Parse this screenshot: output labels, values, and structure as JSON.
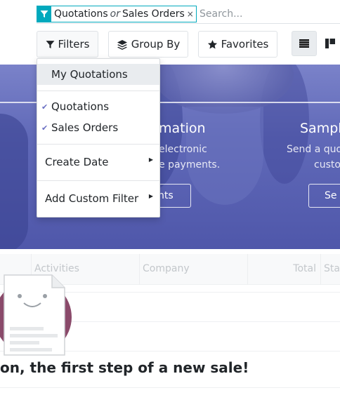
{
  "search": {
    "facet_values": [
      "Quotations",
      "Sales Orders"
    ],
    "facet_separator": "or",
    "facet_remove": "×",
    "placeholder": "Search..."
  },
  "toolbar": {
    "filters_label": "Filters",
    "group_by_label": "Group By",
    "favorites_label": "Favorites"
  },
  "filters_menu": {
    "items": [
      {
        "label": "My Quotations",
        "checked": false,
        "highlighted": true
      },
      {
        "label": "Quotations",
        "checked": true,
        "highlighted": false
      },
      {
        "label": "Sales Orders",
        "checked": true,
        "highlighted": false
      },
      {
        "label": "Create Date",
        "submenu": true
      },
      {
        "label": "Add Custom Filter",
        "submenu": true
      }
    ],
    "check_glyph": "✔",
    "caret_glyph": "▶"
  },
  "hero": {
    "panel1_title": "mation",
    "panel1_line1": "electronic",
    "panel1_line2": "e payments.",
    "panel1_button": "nts",
    "panel2_title": "Sampl",
    "panel2_line1": "Send a quo",
    "panel2_line2": "custo",
    "panel2_button": "Se"
  },
  "table": {
    "columns": [
      "Activities",
      "Company",
      "Total",
      "Sta"
    ]
  },
  "helper": {
    "text": "on, the first step of a new sale!"
  },
  "colors": {
    "accent": "#01a9bd",
    "check": "#6a6fc3",
    "banner": "#5c63b3"
  },
  "icons": {
    "facet": "filter-icon",
    "filters": "filter-icon",
    "group_by": "layers-icon",
    "favorites": "star-icon",
    "list_view": "list-view-icon",
    "kanban_view": "kanban-view-icon"
  }
}
